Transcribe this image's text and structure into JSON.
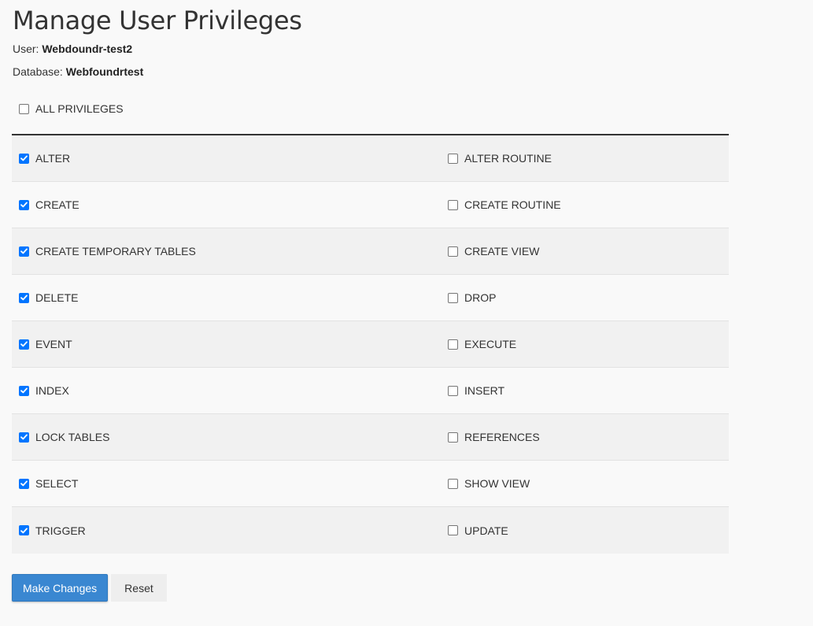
{
  "header": {
    "title": "Manage User Privileges",
    "user_label": "User: ",
    "user_value": "Webdoundr-test2",
    "database_label": "Database: ",
    "database_value": "Webfoundrtest"
  },
  "all_privileges": {
    "label": "ALL PRIVILEGES",
    "checked": false
  },
  "privileges": {
    "rows": [
      {
        "left": {
          "label": "ALTER",
          "checked": true
        },
        "right": {
          "label": "ALTER ROUTINE",
          "checked": false
        }
      },
      {
        "left": {
          "label": "CREATE",
          "checked": true
        },
        "right": {
          "label": "CREATE ROUTINE",
          "checked": false
        }
      },
      {
        "left": {
          "label": "CREATE TEMPORARY TABLES",
          "checked": true
        },
        "right": {
          "label": "CREATE VIEW",
          "checked": false
        }
      },
      {
        "left": {
          "label": "DELETE",
          "checked": true
        },
        "right": {
          "label": "DROP",
          "checked": false
        }
      },
      {
        "left": {
          "label": "EVENT",
          "checked": true
        },
        "right": {
          "label": "EXECUTE",
          "checked": false
        }
      },
      {
        "left": {
          "label": "INDEX",
          "checked": true
        },
        "right": {
          "label": "INSERT",
          "checked": false
        }
      },
      {
        "left": {
          "label": "LOCK TABLES",
          "checked": true
        },
        "right": {
          "label": "REFERENCES",
          "checked": false
        }
      },
      {
        "left": {
          "label": "SELECT",
          "checked": true
        },
        "right": {
          "label": "SHOW VIEW",
          "checked": false
        }
      },
      {
        "left": {
          "label": "TRIGGER",
          "checked": true
        },
        "right": {
          "label": "UPDATE",
          "checked": false
        }
      }
    ]
  },
  "actions": {
    "submit_label": "Make Changes",
    "reset_label": "Reset"
  },
  "colors": {
    "primary": "#3a87d1",
    "checkbox_checked": "#0075ff",
    "row_alt": "#f1f1f1",
    "background": "#f9f9f9"
  }
}
